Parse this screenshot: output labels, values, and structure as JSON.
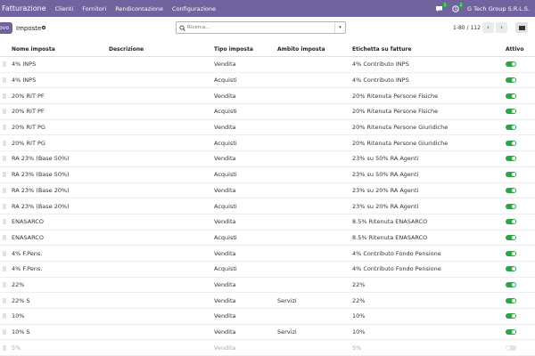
{
  "navbar": {
    "brand": "Fatturazione",
    "menu": [
      "Clienti",
      "Fornitori",
      "Rendicontazione",
      "Configurazione"
    ],
    "chat_badge": "1",
    "activity_badge": "2",
    "company": "G Tech Group S.R.L.S."
  },
  "control": {
    "new_button": "uovo",
    "breadcrumb": "Imposte",
    "search_placeholder": "Ricerca...",
    "pager": "1-80 / 112"
  },
  "table": {
    "headers": {
      "name": "Nome imposta",
      "description": "Descrizione",
      "type": "Tipo imposta",
      "scope": "Ambito imposta",
      "label": "Etichetta su fatture",
      "active": "Attivo"
    },
    "rows": [
      {
        "name": "4% INPS",
        "description": "",
        "type": "Vendita",
        "scope": "",
        "label": "4% Contributo INPS",
        "active": true
      },
      {
        "name": "4% INPS",
        "description": "",
        "type": "Acquisti",
        "scope": "",
        "label": "4% Contributo INPS",
        "active": true
      },
      {
        "name": "20% RIT PF",
        "description": "",
        "type": "Vendita",
        "scope": "",
        "label": "20% Ritenuta Persone Fisiche",
        "active": true
      },
      {
        "name": "20% RIT PF",
        "description": "",
        "type": "Acquisti",
        "scope": "",
        "label": "20% Ritenuta Persone Fisiche",
        "active": true
      },
      {
        "name": "20% RIT PG",
        "description": "",
        "type": "Vendita",
        "scope": "",
        "label": "20% Ritenuta Persone Giuridiche",
        "active": true
      },
      {
        "name": "20% RIT PG",
        "description": "",
        "type": "Acquisti",
        "scope": "",
        "label": "20% Ritenuta Persone Giuridiche",
        "active": true
      },
      {
        "name": "RA 23% (Base 50%)",
        "description": "",
        "type": "Vendita",
        "scope": "",
        "label": "23% su 50% RA Agenti",
        "active": true
      },
      {
        "name": "RA 23% (Base 50%)",
        "description": "",
        "type": "Acquisti",
        "scope": "",
        "label": "23% su 50% RA Agenti",
        "active": true
      },
      {
        "name": "RA 23% (Base 20%)",
        "description": "",
        "type": "Vendita",
        "scope": "",
        "label": "23% su 20% RA Agenti",
        "active": true
      },
      {
        "name": "RA 23% (Base 20%)",
        "description": "",
        "type": "Acquisti",
        "scope": "",
        "label": "23% su 20% RA Agenti",
        "active": true
      },
      {
        "name": "ENASARCO",
        "description": "",
        "type": "Vendita",
        "scope": "",
        "label": "8.5% Ritenuta ENASARCO",
        "active": true
      },
      {
        "name": "ENASARCO",
        "description": "",
        "type": "Acquisti",
        "scope": "",
        "label": "8.5% Ritenuta ENASARCO",
        "active": true
      },
      {
        "name": "4% F.Pens.",
        "description": "",
        "type": "Vendita",
        "scope": "",
        "label": "4% Contributo Fondo Pensione",
        "active": true
      },
      {
        "name": "4% F.Pens.",
        "description": "",
        "type": "Acquisti",
        "scope": "",
        "label": "4% Contributo Fondo Pensione",
        "active": true
      },
      {
        "name": "22%",
        "description": "",
        "type": "Vendita",
        "scope": "",
        "label": "22%",
        "active": true
      },
      {
        "name": "22% S",
        "description": "",
        "type": "Vendita",
        "scope": "Servizi",
        "label": "22%",
        "active": true
      },
      {
        "name": "10%",
        "description": "",
        "type": "Vendita",
        "scope": "",
        "label": "10%",
        "active": true
      },
      {
        "name": "10% S",
        "description": "",
        "type": "Vendita",
        "scope": "Servizi",
        "label": "10%",
        "active": true
      },
      {
        "name": "5%",
        "description": "",
        "type": "Vendita",
        "scope": "",
        "label": "5%",
        "active": false
      }
    ]
  },
  "icons": {
    "handle": "drag-handle-icon",
    "gear": "gear-icon",
    "search": "search-icon",
    "chat": "chat-icon",
    "activity": "clock-icon"
  },
  "colors": {
    "brand": "#71639e",
    "toggle_on": "#28a745",
    "toggle_off": "#e4e4e4"
  }
}
